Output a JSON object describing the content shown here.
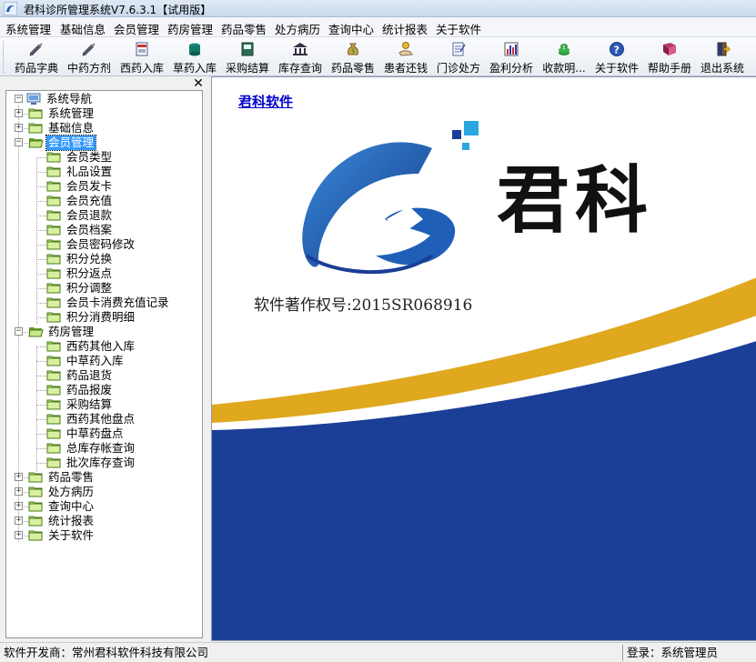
{
  "window": {
    "title": "君科诊所管理系统V7.6.3.1【试用版】"
  },
  "menu": [
    "系统管理",
    "基础信息",
    "会员管理",
    "药房管理",
    "药品零售",
    "处方病历",
    "查询中心",
    "统计报表",
    "关于软件"
  ],
  "toolbar": [
    {
      "label": "药品字典",
      "icon": "syringe-icon"
    },
    {
      "label": "中药方剂",
      "icon": "syringe-icon"
    },
    {
      "label": "西药入库",
      "icon": "notebook-icon"
    },
    {
      "label": "草药入库",
      "icon": "jar-icon"
    },
    {
      "label": "采购结算",
      "icon": "ledger-icon"
    },
    {
      "label": "库存查询",
      "icon": "building-icon"
    },
    {
      "label": "药品零售",
      "icon": "money-bag-icon"
    },
    {
      "label": "患者还钱",
      "icon": "hand-coin-icon"
    },
    {
      "label": "门诊处方",
      "icon": "prescription-icon"
    },
    {
      "label": "盈利分析",
      "icon": "bar-chart-icon"
    },
    {
      "label": "收款明...",
      "icon": "coins-icon"
    },
    {
      "label": "关于软件",
      "icon": "help-icon"
    },
    {
      "label": "帮助手册",
      "icon": "book-icon"
    },
    {
      "label": "退出系统",
      "icon": "exit-door-icon"
    }
  ],
  "tree": {
    "root": "系统导航",
    "items": [
      {
        "label": "系统管理",
        "level": 1,
        "expanded": false
      },
      {
        "label": "基础信息",
        "level": 1,
        "expanded": false
      },
      {
        "label": "会员管理",
        "level": 1,
        "expanded": true,
        "selected": true
      },
      {
        "label": "会员类型",
        "level": 2
      },
      {
        "label": "礼品设置",
        "level": 2
      },
      {
        "label": "会员发卡",
        "level": 2
      },
      {
        "label": "会员充值",
        "level": 2
      },
      {
        "label": "会员退款",
        "level": 2
      },
      {
        "label": "会员档案",
        "level": 2
      },
      {
        "label": "会员密码修改",
        "level": 2
      },
      {
        "label": "积分兑换",
        "level": 2
      },
      {
        "label": "积分返点",
        "level": 2
      },
      {
        "label": "积分调整",
        "level": 2
      },
      {
        "label": "会员卡消费充值记录",
        "level": 2
      },
      {
        "label": "积分消费明细",
        "level": 2
      },
      {
        "label": "药房管理",
        "level": 1,
        "expanded": true
      },
      {
        "label": "西药其他入库",
        "level": 2
      },
      {
        "label": "中草药入库",
        "level": 2
      },
      {
        "label": "药品退货",
        "level": 2
      },
      {
        "label": "药品报废",
        "level": 2
      },
      {
        "label": "采购结算",
        "level": 2
      },
      {
        "label": "西药其他盘点",
        "level": 2
      },
      {
        "label": "中草药盘点",
        "level": 2
      },
      {
        "label": "总库存帐查询",
        "level": 2
      },
      {
        "label": "批次库存查询",
        "level": 2
      },
      {
        "label": "药品零售",
        "level": 1,
        "expanded": false
      },
      {
        "label": "处方病历",
        "level": 1,
        "expanded": false
      },
      {
        "label": "查询中心",
        "level": 1,
        "expanded": false
      },
      {
        "label": "统计报表",
        "level": 1,
        "expanded": false
      },
      {
        "label": "关于软件",
        "level": 1,
        "expanded": false
      }
    ]
  },
  "main": {
    "brand_link": "君科软件",
    "logo_text": "君科",
    "copyright": "软件著作权号:2015SR068916"
  },
  "status": {
    "developer": "软件开发商：常州君科软件科技有限公司",
    "login": "登录：系统管理员"
  },
  "colors": {
    "wave_blue": "#1b3e97",
    "wave_gold": "#e0a81e",
    "logo_blue": "#1f5fb8",
    "selection": "#3399ff"
  }
}
